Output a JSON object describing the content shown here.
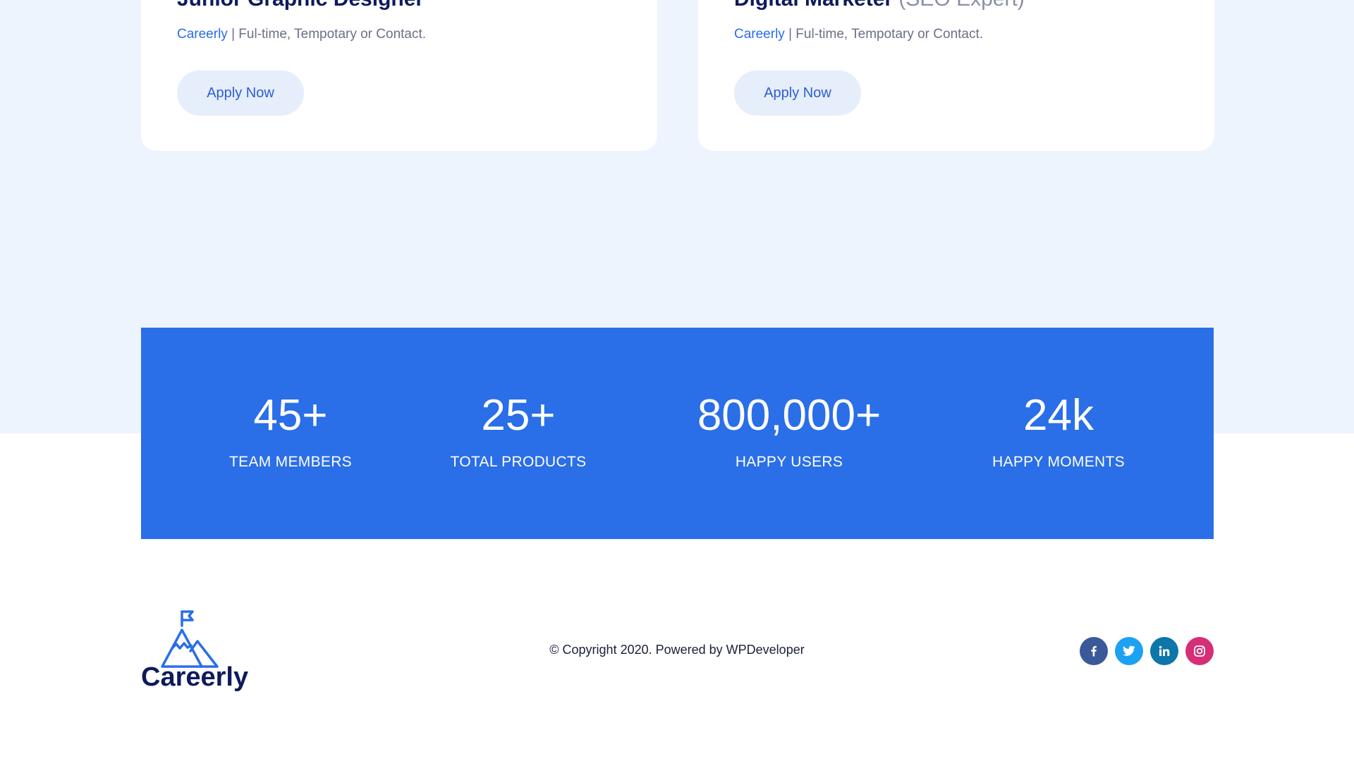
{
  "jobs": [
    {
      "title": "Junior Graphic Designer",
      "subtitle": "",
      "company": "Careerly",
      "meta": " | Ful-time, Tempotary or Contact.",
      "apply_label": "Apply Now"
    },
    {
      "title": "Digital Marketer",
      "subtitle": " (SEO Expert)",
      "company": "Careerly",
      "meta": " | Ful-time, Tempotary or Contact.",
      "apply_label": "Apply Now"
    }
  ],
  "stats": [
    {
      "value": "45+",
      "label": "TEAM MEMBERS"
    },
    {
      "value": "25+",
      "label": "TOTAL PRODUCTS"
    },
    {
      "value": "800,000+",
      "label": "HAPPY USERS"
    },
    {
      "value": "24k",
      "label": "HAPPY MOMENTS"
    }
  ],
  "footer": {
    "logo_text": "Careerly",
    "copyright": "© Copyright 2020. Powered by WPDeveloper",
    "social": [
      {
        "icon": "facebook-icon",
        "color": "#3b5998"
      },
      {
        "icon": "twitter-icon",
        "color": "#1da1f2"
      },
      {
        "icon": "linkedin-icon",
        "color": "#0e76a8"
      },
      {
        "icon": "instagram-icon",
        "color": "#d62e77"
      }
    ]
  },
  "colors": {
    "accent": "#2a6ee8",
    "navy": "#0f1a5c",
    "page_bg": "#eef4fe"
  }
}
